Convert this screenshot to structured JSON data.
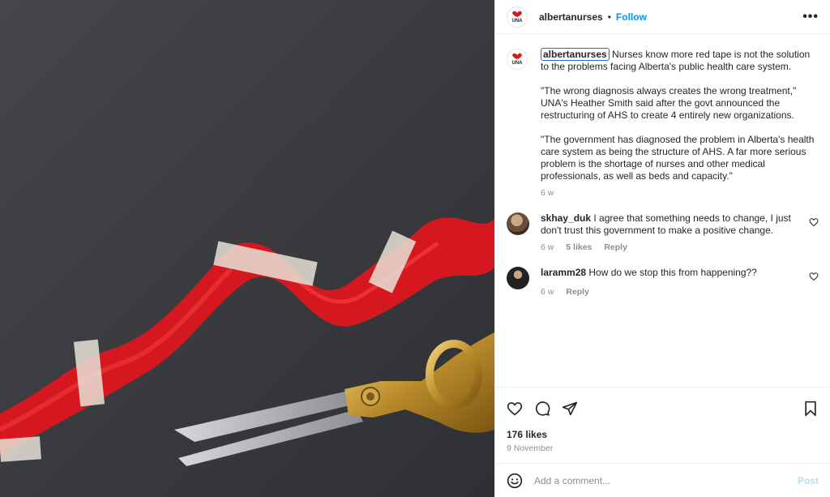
{
  "post": {
    "username": "albertanurses",
    "follow_label": "Follow",
    "dot": "•",
    "more_label": "•••",
    "avatar_text": "UNA"
  },
  "caption": {
    "username": "albertanurses",
    "paragraph1": "Nurses know more red tape is not the solution to the problems facing Alberta's public health care system.",
    "paragraph2": "\"The wrong diagnosis always creates the wrong treatment,\" UNA's Heather Smith said after the govt announced the restructuring of AHS to create 4 entirely new organizations.",
    "paragraph3": "\"The government has diagnosed the problem in Alberta's health care system as being the structure of AHS. A far more serious problem is the shortage of nurses and other medical professionals, as well as beds and capacity.\"",
    "time": "6 w"
  },
  "comments": [
    {
      "username": "skhay_duk",
      "text": "I agree that something needs to change, I just don't trust this government to make a positive change.",
      "time": "6 w",
      "likes": "5 likes",
      "reply": "Reply"
    },
    {
      "username": "laramm28",
      "text": "How do we stop this from happening??",
      "time": "6 w",
      "reply": "Reply"
    }
  ],
  "footer": {
    "likes": "176 likes",
    "date": "9 November",
    "comment_placeholder": "Add a comment...",
    "post_label": "Post"
  },
  "colors": {
    "accent": "#0095f6",
    "ribbon": "#e01b22",
    "slate": "#3a3b3f"
  },
  "icons": [
    "heart-icon",
    "comment-icon",
    "share-icon",
    "bookmark-icon",
    "emoji-icon",
    "more-icon"
  ]
}
